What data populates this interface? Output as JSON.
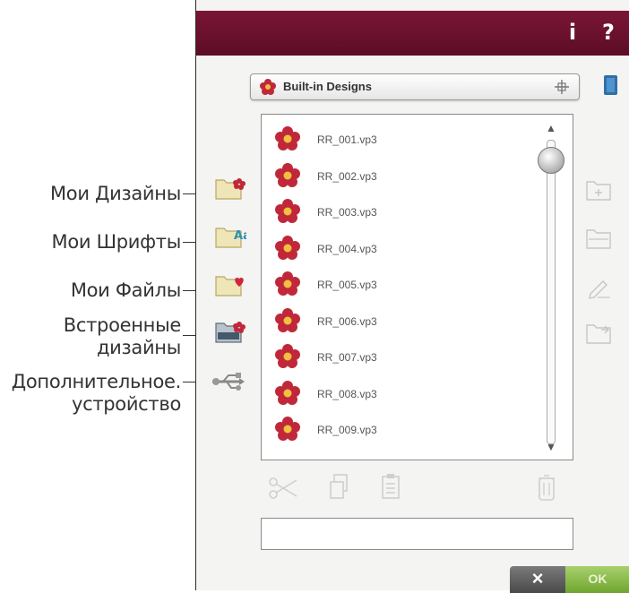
{
  "annotations": {
    "my_designs": "Мои Дизайны",
    "my_fonts": "Мои Шрифты",
    "my_files": "Мои Файлы",
    "builtin_line1": "Встроенные",
    "builtin_line2": "дизайны",
    "device_line1": "Дополнительное.",
    "device_line2": "устройство"
  },
  "titlebar": {
    "info_label": "i",
    "help_label": "?"
  },
  "location_dropdown": {
    "selected": "Built-in Designs"
  },
  "files": [
    "RR_001.vp3",
    "RR_002.vp3",
    "RR_003.vp3",
    "RR_004.vp3",
    "RR_005.vp3",
    "RR_006.vp3",
    "RR_007.vp3",
    "RR_008.vp3",
    "RR_009.vp3"
  ],
  "filename_field": {
    "value": ""
  },
  "dialog_buttons": {
    "cancel_label": "×",
    "ok_label": "OK"
  },
  "colors": {
    "titlebar": "#6a1230",
    "ok_green": "#8cc04e",
    "flower_red": "#c0283a"
  }
}
